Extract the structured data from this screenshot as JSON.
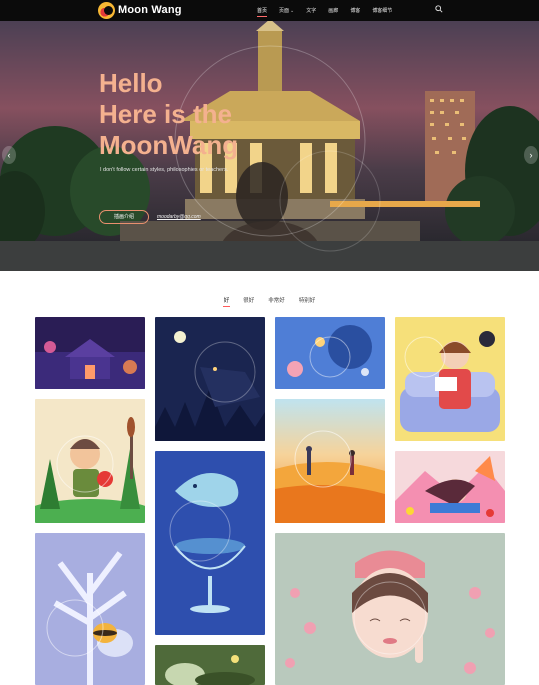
{
  "header": {
    "brand": "Moon Wang",
    "nav": [
      {
        "label": "首页",
        "active": true
      },
      {
        "label": "页面",
        "has_dropdown": true
      },
      {
        "label": "文字"
      },
      {
        "label": "画廊"
      },
      {
        "label": "博客"
      },
      {
        "label": "博客细节"
      }
    ]
  },
  "hero": {
    "title_line1": "Hello",
    "title_line2": "Here is the",
    "title_line3": "MoonWang",
    "subtitle": "I don't follow certain styles, philosophies or teachers.",
    "button_label": "插画介绍",
    "link_text": "moodarby@qq.com"
  },
  "tabs": [
    {
      "label": "好",
      "active": true
    },
    {
      "label": "很好"
    },
    {
      "label": "非常好"
    },
    {
      "label": "特别好"
    }
  ],
  "gallery": [
    {
      "name": "purple-temple-night"
    },
    {
      "name": "moon-night-forest"
    },
    {
      "name": "planets-space"
    },
    {
      "name": "girl-reading-sofa"
    },
    {
      "name": "boy-with-crab"
    },
    {
      "name": "whale-in-glass"
    },
    {
      "name": "couple-sunset-field"
    },
    {
      "name": "girl-lying-petals"
    },
    {
      "name": "bee-winter-tree"
    },
    {
      "name": "forest-creature"
    },
    {
      "name": "girl-with-flowers"
    }
  ],
  "colors": {
    "header_bg": "#0b0b0b",
    "hero_title": "#f4b18f",
    "accent": "#ff5a5a"
  }
}
